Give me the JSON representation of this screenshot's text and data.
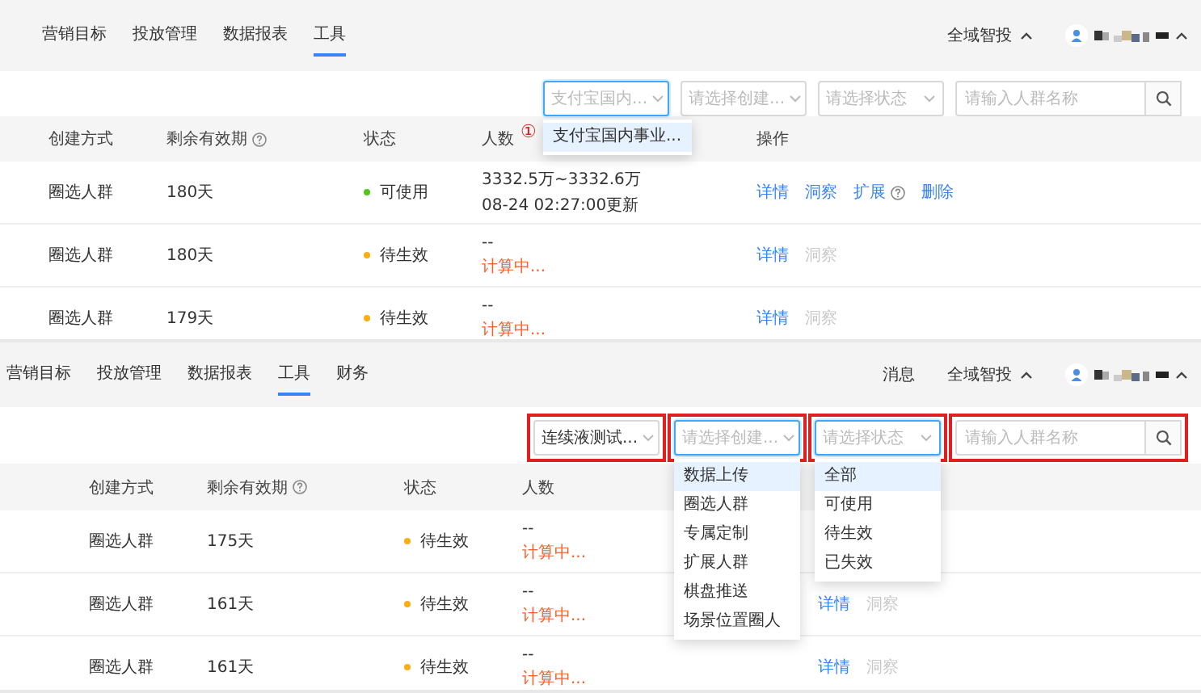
{
  "screens": [
    {
      "nav": {
        "tabs": [
          {
            "label": "营销目标",
            "selected": false
          },
          {
            "label": "投放管理",
            "selected": false
          },
          {
            "label": "数据报表",
            "selected": false
          },
          {
            "label": "工具",
            "selected": true
          }
        ],
        "right": [
          {
            "label": "全域智投",
            "kind": "dropdown"
          }
        ]
      },
      "filters": [
        {
          "kind": "select",
          "placeholder": "支付宝国内...",
          "focused": true,
          "highlighted": false,
          "menu": {
            "marker": "①",
            "items": [
              {
                "label": "支付宝国内事业...",
                "selected": true
              }
            ]
          }
        },
        {
          "kind": "select",
          "placeholder": "请选择创建...",
          "focused": false,
          "highlighted": false
        },
        {
          "kind": "select",
          "placeholder": "请选择状态",
          "focused": false,
          "highlighted": false
        },
        {
          "kind": "search",
          "placeholder": "请输入人群名称",
          "focused": false,
          "highlighted": false
        }
      ],
      "table": {
        "columns": [
          {
            "label": "创建方式",
            "kind": "data",
            "help": false
          },
          {
            "label": "剩余有效期",
            "kind": "data",
            "help": true
          },
          {
            "label": "状态",
            "kind": "data",
            "help": false
          },
          {
            "label": "人数",
            "kind": "data",
            "help": false
          },
          {
            "label": "操作",
            "kind": "actions",
            "help": false
          }
        ],
        "rows": [
          {
            "method": "圈选人群",
            "validity": "180天",
            "status": {
              "label": "可使用",
              "color": "#52c41a"
            },
            "count": [
              {
                "text": "3332.5万~3332.6万",
                "kind": "value"
              },
              {
                "text": "08-24 02:27:00更新",
                "kind": "value"
              }
            ],
            "actions": [
              {
                "label": "详情",
                "disabled": false,
                "help": false
              },
              {
                "label": "洞察",
                "disabled": false,
                "help": false
              },
              {
                "label": "扩展",
                "disabled": false,
                "help": true
              },
              {
                "label": "删除",
                "disabled": false,
                "help": false
              }
            ]
          },
          {
            "method": "圈选人群",
            "validity": "180天",
            "status": {
              "label": "待生效",
              "color": "#faad14"
            },
            "count": [
              {
                "text": "--",
                "kind": "value"
              },
              {
                "text": "计算中...",
                "kind": "pending"
              }
            ],
            "actions": [
              {
                "label": "详情",
                "disabled": false,
                "help": false
              },
              {
                "label": "洞察",
                "disabled": true,
                "help": false
              }
            ]
          },
          {
            "method": "圈选人群",
            "validity": "179天",
            "status": {
              "label": "待生效",
              "color": "#faad14"
            },
            "count": [
              {
                "text": "--",
                "kind": "value"
              },
              {
                "text": "计算中...",
                "kind": "pending"
              }
            ],
            "actions": [
              {
                "label": "详情",
                "disabled": false,
                "help": false
              },
              {
                "label": "洞察",
                "disabled": true,
                "help": false
              }
            ]
          }
        ]
      }
    },
    {
      "nav": {
        "tabs": [
          {
            "label": "营销目标",
            "selected": false
          },
          {
            "label": "投放管理",
            "selected": false
          },
          {
            "label": "数据报表",
            "selected": false
          },
          {
            "label": "工具",
            "selected": true
          },
          {
            "label": "财务",
            "selected": false
          }
        ],
        "right": [
          {
            "label": "消息",
            "kind": "text"
          },
          {
            "label": "全域智投",
            "kind": "dropdown"
          }
        ]
      },
      "filters": [
        {
          "kind": "select",
          "value": "连续液测试...",
          "focused": false,
          "highlighted": true
        },
        {
          "kind": "select",
          "placeholder": "请选择创建...",
          "focused": true,
          "highlighted": true,
          "menu": {
            "items": [
              {
                "label": "数据上传",
                "selected": true
              },
              {
                "label": "圈选人群",
                "selected": false
              },
              {
                "label": "专属定制",
                "selected": false
              },
              {
                "label": "扩展人群",
                "selected": false
              },
              {
                "label": "棋盘推送",
                "selected": false
              },
              {
                "label": "场景位置圈人",
                "selected": false
              }
            ]
          }
        },
        {
          "kind": "select",
          "placeholder": "请选择状态",
          "focused": true,
          "highlighted": true,
          "menu": {
            "items": [
              {
                "label": "全部",
                "selected": true
              },
              {
                "label": "可使用",
                "selected": false
              },
              {
                "label": "待生效",
                "selected": false
              },
              {
                "label": "已失效",
                "selected": false
              }
            ]
          }
        },
        {
          "kind": "search",
          "placeholder": "请输入人群名称",
          "focused": false,
          "highlighted": true
        }
      ],
      "table": {
        "columns": [
          {
            "label": "创建方式",
            "kind": "data",
            "help": false
          },
          {
            "label": "剩余有效期",
            "kind": "data",
            "help": true
          },
          {
            "label": "状态",
            "kind": "data",
            "help": false
          },
          {
            "label": "人数",
            "kind": "data",
            "help": false
          }
        ],
        "rows": [
          {
            "method": "圈选人群",
            "validity": "175天",
            "status": {
              "label": "待生效",
              "color": "#faad14"
            },
            "count": [
              {
                "text": "--",
                "kind": "value"
              },
              {
                "text": "计算中...",
                "kind": "pending"
              }
            ],
            "actions": []
          },
          {
            "method": "圈选人群",
            "validity": "161天",
            "status": {
              "label": "待生效",
              "color": "#faad14"
            },
            "count": [
              {
                "text": "--",
                "kind": "value"
              },
              {
                "text": "计算中...",
                "kind": "pending"
              }
            ],
            "actions": [
              {
                "label": "详情",
                "disabled": false,
                "help": false
              },
              {
                "label": "洞察",
                "disabled": true,
                "help": false
              }
            ]
          },
          {
            "method": "圈选人群",
            "validity": "161天",
            "status": {
              "label": "待生效",
              "color": "#faad14"
            },
            "count": [
              {
                "text": "--",
                "kind": "value"
              },
              {
                "text": "计算中...",
                "kind": "pending"
              }
            ],
            "actions": [
              {
                "label": "详情",
                "disabled": false,
                "help": false
              },
              {
                "label": "洞察",
                "disabled": true,
                "help": false
              }
            ]
          }
        ]
      }
    }
  ]
}
